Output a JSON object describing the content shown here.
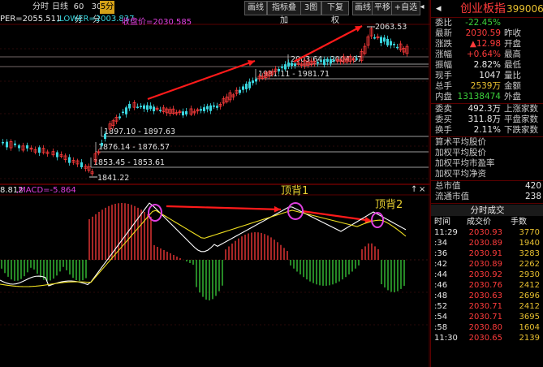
{
  "toolbar": {
    "periods": [
      "分时",
      "日线",
      "60分",
      "30分",
      "5分"
    ],
    "active_period": "5分",
    "buttons": [
      "画线",
      "指标叠加",
      "3图",
      "下复权",
      "画线",
      "平移",
      "+自选"
    ]
  },
  "indicator_top": {
    "upper": "PER=2055.511",
    "lower": ",LOWER=2003.837",
    "close": "收盘价=2030.585"
  },
  "indicator_macd": {
    "diff": "8.812",
    "macd": ",MACD=-5.864"
  },
  "annotations": {
    "top1": "顶背1",
    "top2": "顶背2"
  },
  "price_labels": {
    "high": "2063.53",
    "l1": "2003.64 - 2004.07",
    "l2": "1981.11 - 1981.71",
    "l3": "1897.10 - 1897.63",
    "l4": "1876.14 - 1876.57",
    "l5": "1853.45 - 1853.61",
    "low": "1841.22"
  },
  "colors": {
    "up": "#ff3b3b",
    "down": "#3ad7e0",
    "macd_down": "#3bd13b",
    "diff": "#ffffff",
    "dea": "#f0e020"
  },
  "panel": {
    "title": "创业板指",
    "code": "399006",
    "weibi_label": "委比",
    "weibi_value": "-22.45%",
    "left_rows": [
      {
        "label": "最新",
        "value": "2030.59",
        "right": "昨收",
        "cls": "red"
      },
      {
        "label": "涨跌",
        "value": "▲12.98",
        "right": "开盘",
        "cls": "red"
      },
      {
        "label": "涨幅",
        "value": "+0.64%",
        "right": "最高",
        "cls": "red"
      },
      {
        "label": "振幅",
        "value": "2.82%",
        "right": "最低",
        "cls": "white"
      },
      {
        "label": "现手",
        "value": "1047",
        "right": "量比",
        "cls": "white"
      },
      {
        "label": "总手",
        "value": "2539万",
        "right": "金额",
        "cls": "gold"
      },
      {
        "label": "内盘",
        "value": "13138474",
        "right": "外盘",
        "cls": "green"
      }
    ],
    "mid_rows": [
      {
        "label": "委卖",
        "value": "492.3万",
        "right": "上涨家数",
        "cls": "white"
      },
      {
        "label": "委买",
        "value": "311.8万",
        "right": "平盘家数",
        "cls": "white"
      },
      {
        "label": "换手",
        "value": "2.11%",
        "right": "下跌家数",
        "cls": "white"
      }
    ],
    "list_rows": [
      "算术平均股价",
      "加权平均股价",
      "加权平均市盈率",
      "加权平均净资"
    ],
    "cap_rows": [
      {
        "label": "总市值",
        "value": "420"
      },
      {
        "label": "流通市值",
        "value": "238"
      }
    ],
    "ticks_header": "分时成交",
    "ticks_cols": [
      "时间",
      "成交价",
      "手数"
    ],
    "ticks": [
      {
        "t": "11:29",
        "p": "2030.93",
        "v": "3770",
        "c": "red"
      },
      {
        "t": ":34",
        "p": "2030.89",
        "v": "1940",
        "c": "red"
      },
      {
        "t": ":36",
        "p": "2030.91",
        "v": "3283",
        "c": "red"
      },
      {
        "t": ":42",
        "p": "2030.89",
        "v": "2262",
        "c": "red"
      },
      {
        "t": ":44",
        "p": "2030.92",
        "v": "2930",
        "c": "red"
      },
      {
        "t": ":46",
        "p": "2030.76",
        "v": "2412",
        "c": "red"
      },
      {
        "t": ":48",
        "p": "2030.63",
        "v": "2696",
        "c": "red"
      },
      {
        "t": ":52",
        "p": "2030.71",
        "v": "2412",
        "c": "red"
      },
      {
        "t": ":54",
        "p": "2030.71",
        "v": "3695",
        "c": "red"
      },
      {
        "t": ":58",
        "p": "2030.80",
        "v": "1604",
        "c": "red"
      },
      {
        "t": "11:30",
        "p": "2030.65",
        "v": "2139",
        "c": "red"
      }
    ]
  }
}
